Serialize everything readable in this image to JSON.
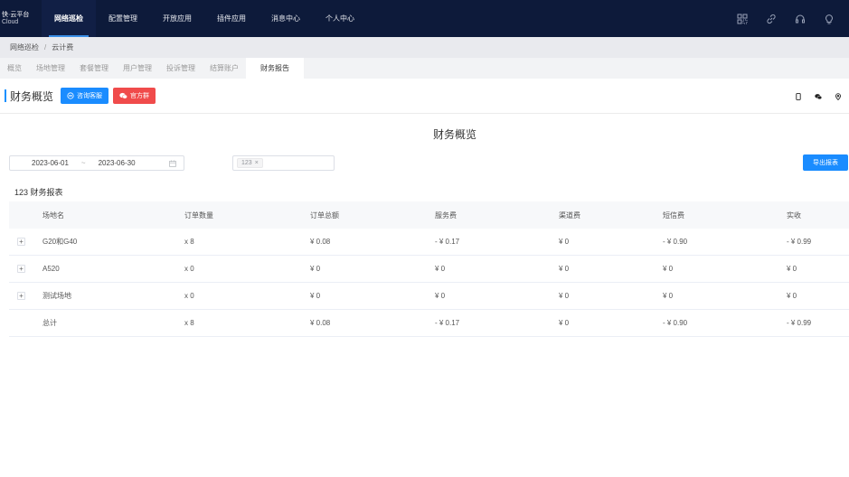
{
  "topnav": {
    "brand_line1": "快·云平台",
    "brand_line2": "Cloud",
    "items": [
      {
        "label": "网络巡检",
        "active": true
      },
      {
        "label": "配置管理",
        "active": false
      },
      {
        "label": "开放应用",
        "active": false
      },
      {
        "label": "插件应用",
        "active": false
      },
      {
        "label": "消息中心",
        "active": false
      },
      {
        "label": "个人中心",
        "active": false
      }
    ],
    "icons": [
      "grid-icon",
      "link-icon",
      "headset-icon",
      "bulb-icon"
    ]
  },
  "breadcrumb": {
    "root": "网络巡检",
    "separator": "/",
    "current": "云计费"
  },
  "subtabs": [
    {
      "label": "概览",
      "active": false
    },
    {
      "label": "场地管理",
      "active": false
    },
    {
      "label": "套餐管理",
      "active": false
    },
    {
      "label": "用户管理",
      "active": false
    },
    {
      "label": "投诉管理",
      "active": false
    },
    {
      "label": "结算账户",
      "active": false
    },
    {
      "label": "财务报告",
      "active": true
    }
  ],
  "titlerow": {
    "title": "财务概览",
    "consult_label": "咨询客服",
    "group_label": "官方群",
    "right_icons": [
      "phone-icon",
      "wechat-icon",
      "location-icon"
    ]
  },
  "report": {
    "heading": "财务概览",
    "date_start": "2023-06-01",
    "date_sep": "~",
    "date_end": "2023-06-30",
    "selected_tag": "123",
    "export_label": "导出报表",
    "table_caption": "123 财务报表"
  },
  "table": {
    "headers": [
      "场地名",
      "订单数量",
      "订单总额",
      "服务费",
      "渠道费",
      "短信费",
      "实收"
    ],
    "rows": [
      {
        "expand": "+",
        "name": "G20和G40",
        "count": "x 8",
        "amount": "¥ 0.08",
        "service": "- ¥ 0.17",
        "channel": "¥ 0",
        "sms": "- ¥ 0.90",
        "received": "- ¥ 0.99"
      },
      {
        "expand": "+",
        "name": "A520",
        "count": "x 0",
        "amount": "¥ 0",
        "service": "¥ 0",
        "channel": "¥ 0",
        "sms": "¥ 0",
        "received": "¥ 0"
      },
      {
        "expand": "+",
        "name": "测试场地",
        "count": "x 0",
        "amount": "¥ 0",
        "service": "¥ 0",
        "channel": "¥ 0",
        "sms": "¥ 0",
        "received": "¥ 0"
      },
      {
        "expand": "",
        "name": "总计",
        "count": "x 8",
        "amount": "¥ 0.08",
        "service": "- ¥ 0.17",
        "channel": "¥ 0",
        "sms": "- ¥ 0.90",
        "received": "- ¥ 0.99"
      }
    ]
  },
  "colors": {
    "nav_bg": "#0d1a3a",
    "primary": "#1a8cff",
    "danger": "#f04b4b"
  }
}
